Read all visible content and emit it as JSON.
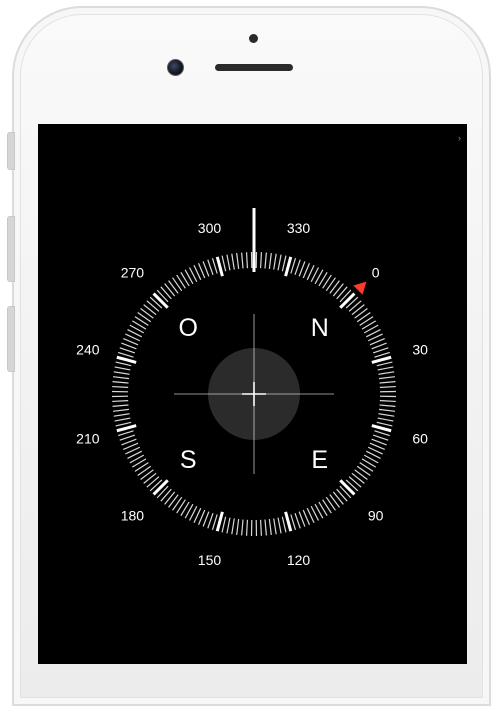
{
  "screen": {
    "status_indicator": "›"
  },
  "compass": {
    "degree_labels": [
      {
        "deg": 0,
        "text": "0"
      },
      {
        "deg": 30,
        "text": "30"
      },
      {
        "deg": 60,
        "text": "60"
      },
      {
        "deg": 90,
        "text": "90"
      },
      {
        "deg": 120,
        "text": "120"
      },
      {
        "deg": 150,
        "text": "150"
      },
      {
        "deg": 180,
        "text": "180"
      },
      {
        "deg": 210,
        "text": "210"
      },
      {
        "deg": 240,
        "text": "240"
      },
      {
        "deg": 270,
        "text": "270"
      },
      {
        "deg": 300,
        "text": "300"
      },
      {
        "deg": 330,
        "text": "330"
      }
    ],
    "cardinals": [
      {
        "deg": 0,
        "text": "N"
      },
      {
        "deg": 90,
        "text": "E"
      },
      {
        "deg": 180,
        "text": "S"
      },
      {
        "deg": 270,
        "text": "O"
      }
    ],
    "current_heading_deg": 315,
    "colors": {
      "background": "#000000",
      "foreground": "#ffffff",
      "north_marker": "#ff3b30",
      "level_disc": "#333333"
    }
  }
}
